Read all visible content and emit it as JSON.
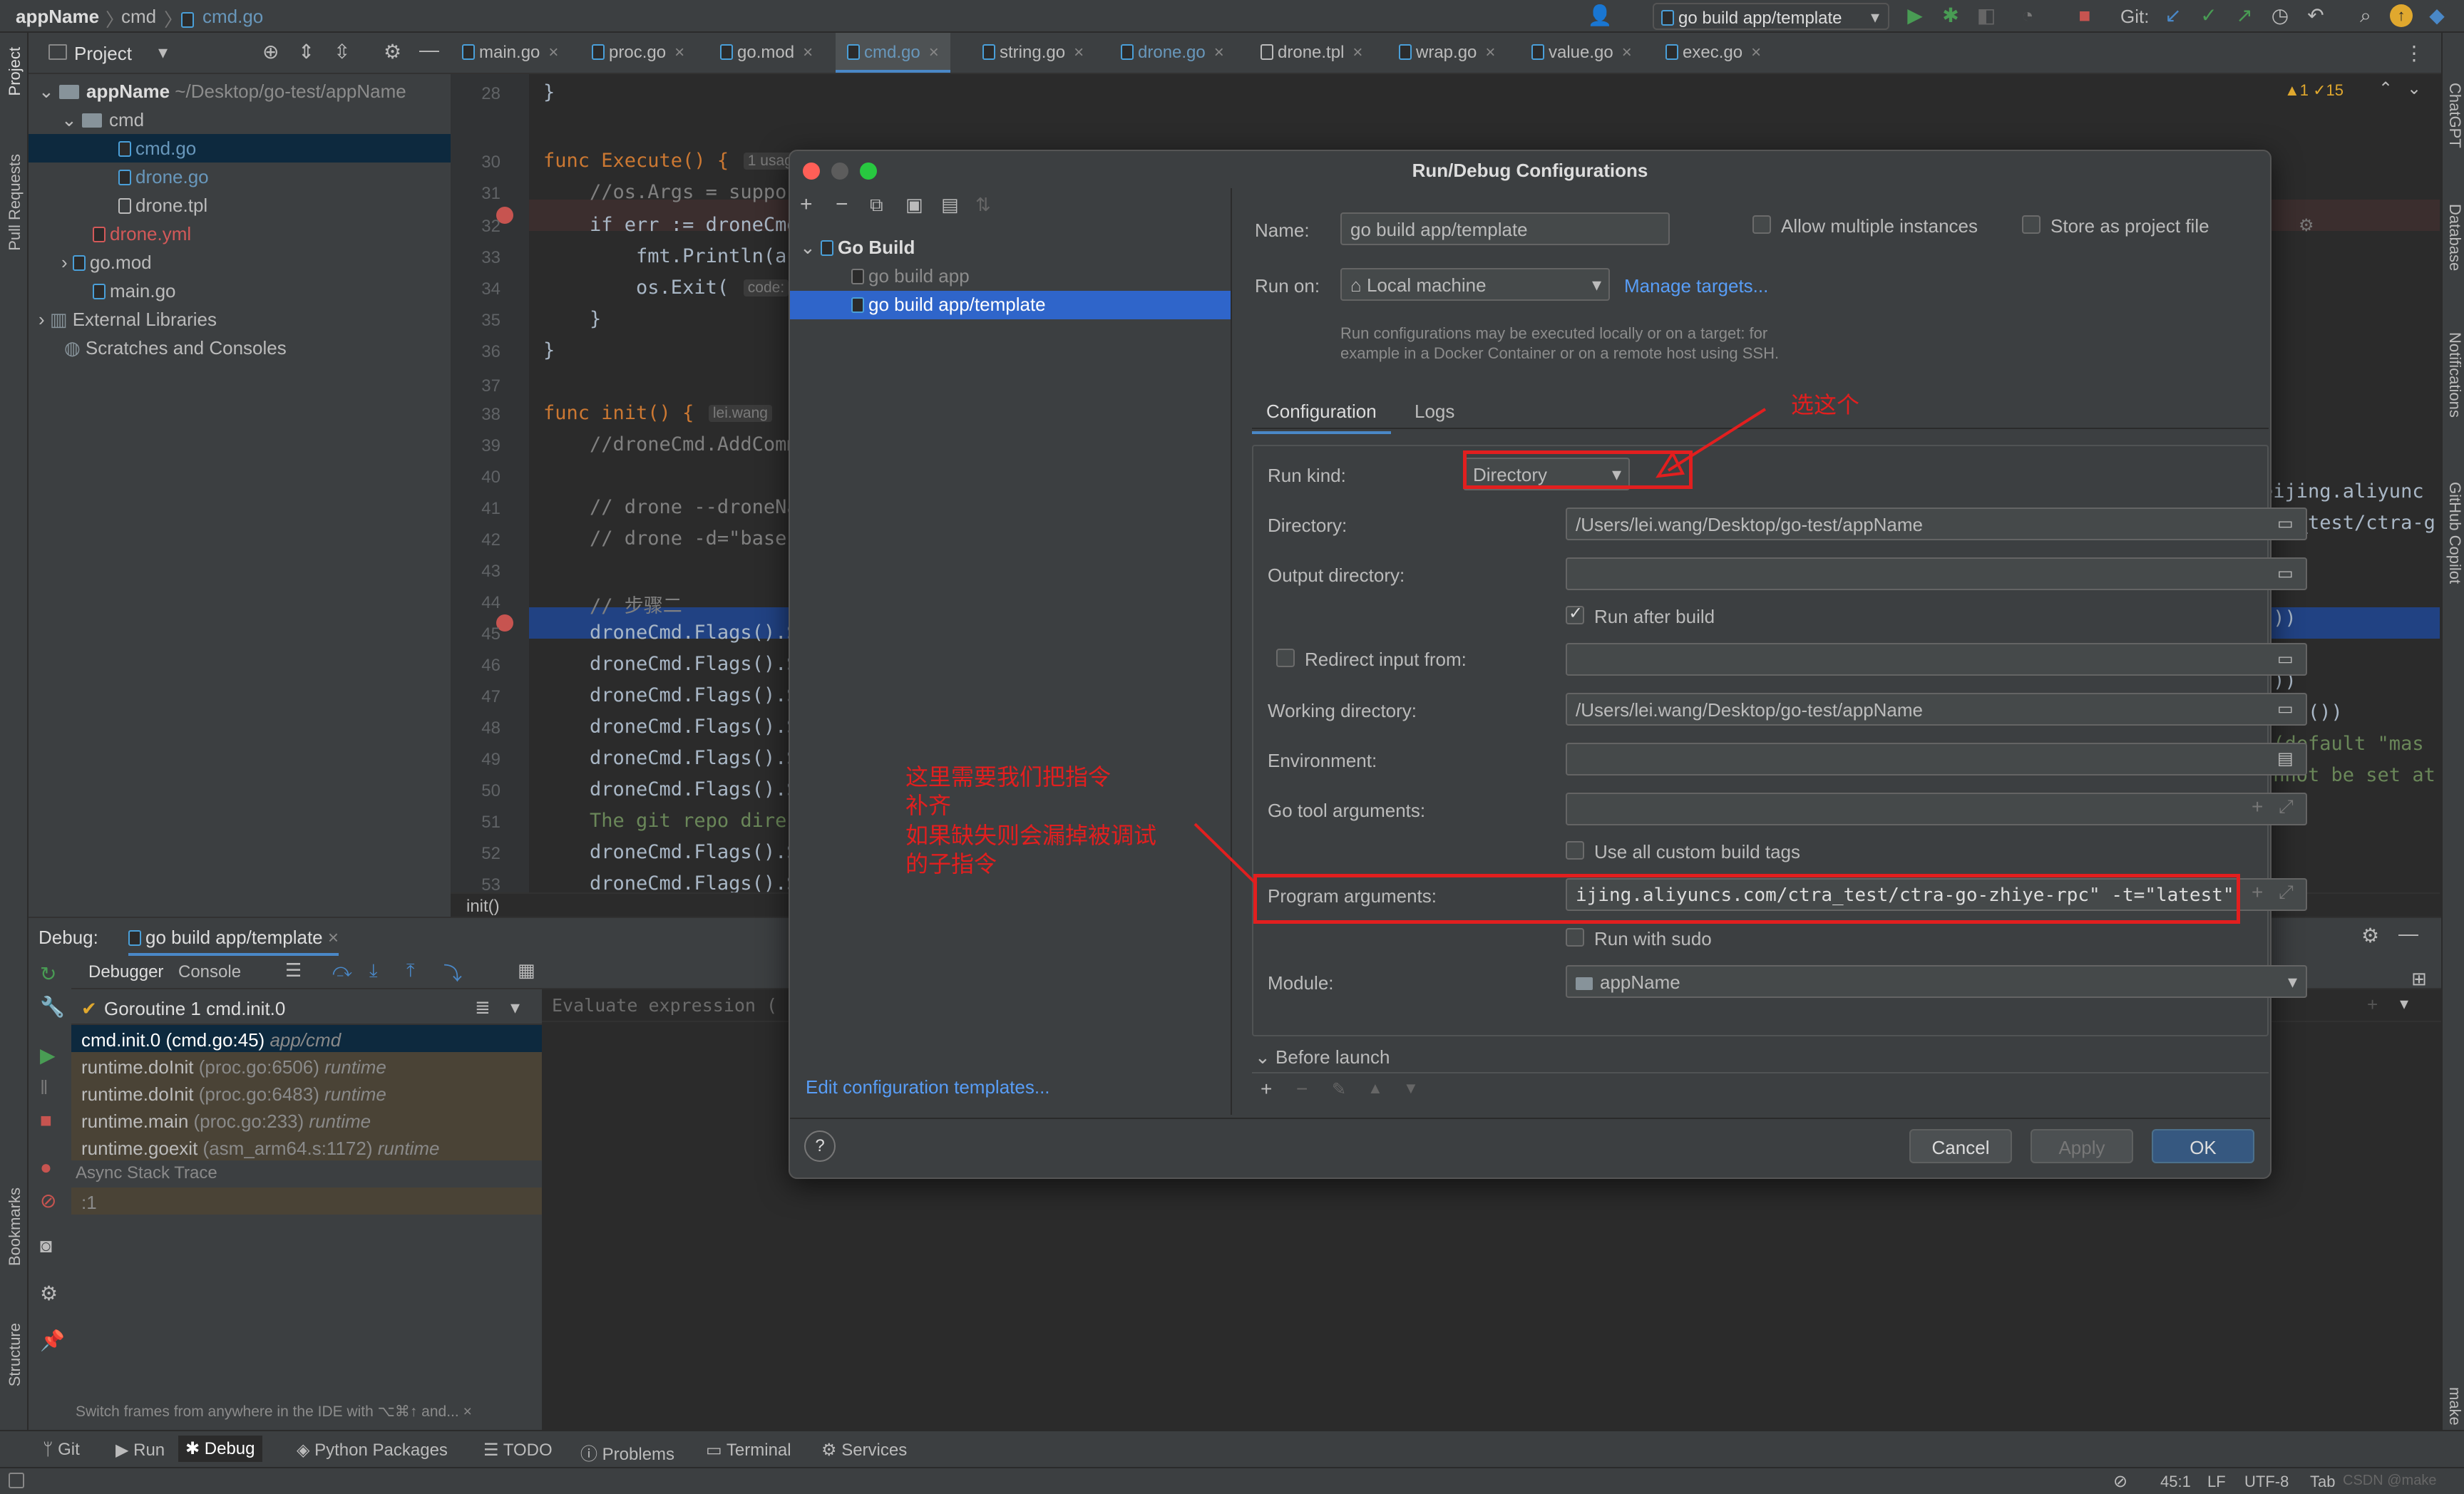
{
  "breadcrumb": {
    "project": "appName",
    "folder": "cmd",
    "file": "cmd.go"
  },
  "toolbar": {
    "run_config": "go build app/template",
    "git_label": "Git:"
  },
  "left_strip": {
    "project": "Project",
    "pull_requests": "Pull Requests",
    "bookmarks": "Bookmarks",
    "structure": "Structure"
  },
  "right_strip": {
    "chatgpt": "ChatGPT",
    "database": "Database",
    "notifications": "Notifications",
    "copilot": "GitHub Copilot",
    "make": "make"
  },
  "project_panel": {
    "title": "Project",
    "items": [
      {
        "label": "appName",
        "sub": "~/Desktop/go-test/appName"
      },
      {
        "label": "cmd"
      },
      {
        "label": "cmd.go"
      },
      {
        "label": "drone.go"
      },
      {
        "label": "drone.tpl"
      },
      {
        "label": "drone.yml"
      },
      {
        "label": "go.mod"
      },
      {
        "label": "main.go"
      },
      {
        "label": "External Libraries"
      },
      {
        "label": "Scratches and Consoles"
      }
    ]
  },
  "tabs": [
    "main.go",
    "proc.go",
    "go.mod",
    "cmd.go",
    "string.go",
    "drone.go",
    "drone.tpl",
    "wrap.go",
    "value.go",
    "exec.go"
  ],
  "editor": {
    "inspections": "▲1  ✓15",
    "lines": [
      {
        "n": "28",
        "text": "}"
      },
      {
        "n": "30",
        "text": "func Execute() {",
        "hint": "1 usag"
      },
      {
        "n": "31",
        "text": "    //os.Args = suppor"
      },
      {
        "n": "32",
        "text": "    if err := droneCmd"
      },
      {
        "n": "33",
        "text": "        fmt.Println(au"
      },
      {
        "n": "34",
        "text": "        os.Exit(",
        "hint": "code:"
      },
      {
        "n": "35",
        "text": "    }"
      },
      {
        "n": "36",
        "text": "}"
      },
      {
        "n": "37",
        "text": ""
      },
      {
        "n": "38",
        "text": "func init() {",
        "hint": "lei.wang"
      },
      {
        "n": "39",
        "text": "    //droneCmd.AddComm"
      },
      {
        "n": "40",
        "text": ""
      },
      {
        "n": "41",
        "text": "    // drone --droneNa"
      },
      {
        "n": "42",
        "text": "    // drone -d=\"base\""
      },
      {
        "n": "43",
        "text": ""
      },
      {
        "n": "44",
        "text": "    // 步骤二"
      },
      {
        "n": "45",
        "text": "    droneCmd.Flags().S"
      },
      {
        "n": "46",
        "text": "    droneCmd.Flags().S"
      },
      {
        "n": "47",
        "text": "    droneCmd.Flags().S"
      },
      {
        "n": "48",
        "text": "    droneCmd.Flags().S"
      },
      {
        "n": "49",
        "text": "    droneCmd.Flags().S"
      },
      {
        "n": "50",
        "text": "    droneCmd.Flags().S"
      },
      {
        "n": "51",
        "text": "    The git repo direc"
      },
      {
        "n": "52",
        "text": "    droneCmd.Flags().S"
      },
      {
        "n": "53",
        "text": "    droneCmd.Flags().S"
      }
    ],
    "right_fragments": [
      "eijing.aliyunc",
      "tra_test/ctra-g",
      "())",
      "())",
      "ring())",
      " (default \"mas",
      "annot be set at"
    ],
    "footer": "init()"
  },
  "debug": {
    "label": "Debug:",
    "session": "go build app/template",
    "tabs": [
      "Debugger",
      "Console"
    ],
    "goroutine": "Goroutine 1 cmd.init.0",
    "eval_placeholder": "Evaluate expression (",
    "frames": [
      {
        "name": "cmd.init.0 (cmd.go:45)",
        "pkg": "app/cmd"
      },
      {
        "name": "runtime.doInit",
        "loc": "(proc.go:6506)",
        "pkg": "runtime"
      },
      {
        "name": "runtime.doInit",
        "loc": "(proc.go:6483)",
        "pkg": "runtime"
      },
      {
        "name": "runtime.main",
        "loc": "(proc.go:233)",
        "pkg": "runtime"
      },
      {
        "name": "runtime.goexit",
        "loc": "(asm_arm64.s:1172)",
        "pkg": "runtime"
      }
    ],
    "async": "Async Stack Trace",
    "async_item": ":1",
    "tip": "Switch frames from anywhere in the IDE with ⌥⌘↑ and..."
  },
  "bottom_tabs": [
    "Git",
    "Run",
    "Debug",
    "Python Packages",
    "TODO",
    "Problems",
    "Terminal",
    "Services"
  ],
  "status": {
    "position": "45:1",
    "line_sep": "LF",
    "encoding": "UTF-8",
    "indent": "Tab",
    "watermark": "CSDN @make"
  },
  "dialog": {
    "title": "Run/Debug Configurations",
    "tree_root": "Go Build",
    "tree_items": [
      "go build app",
      "go build app/template"
    ],
    "edit_templates": "Edit configuration templates...",
    "name_label": "Name:",
    "name_value": "go build app/template",
    "allow_multiple": "Allow multiple instances",
    "store_project": "Store as project file",
    "run_on_label": "Run on:",
    "run_on_value": "Local machine",
    "manage_targets": "Manage targets...",
    "run_on_hint": "Run configurations may be executed locally or on a target: for\nexample in a Docker Container or on a remote host using SSH.",
    "tabs": [
      "Configuration",
      "Logs"
    ],
    "run_kind_label": "Run kind:",
    "run_kind_value": "Directory",
    "directory_label": "Directory:",
    "directory_value": "/Users/lei.wang/Desktop/go-test/appName",
    "output_dir_label": "Output directory:",
    "run_after_build": "Run after build",
    "redirect_input": "Redirect input from:",
    "working_dir_label": "Working directory:",
    "working_dir_value": "/Users/lei.wang/Desktop/go-test/appName",
    "environment_label": "Environment:",
    "go_tool_args_label": "Go tool arguments:",
    "use_custom_tags": "Use all custom build tags",
    "program_args_label": "Program arguments:",
    "program_args_value": "ijing.aliyuncs.com/ctra_test/ctra-go-zhiye-rpc\" -t=\"latest\"",
    "run_with_sudo": "Run with sudo",
    "module_label": "Module:",
    "module_value": "appName",
    "before_launch": "Before launch",
    "cancel": "Cancel",
    "apply": "Apply",
    "ok": "OK"
  },
  "annotations": {
    "select_this": "选这个",
    "note": [
      "这里需要我们把指令",
      "补齐",
      "如果缺失则会漏掉被调试",
      "的子指令"
    ]
  },
  "colors": {
    "annotation": "#e21f1f",
    "accent": "#4a88c7",
    "selection": "#2f65ca"
  }
}
